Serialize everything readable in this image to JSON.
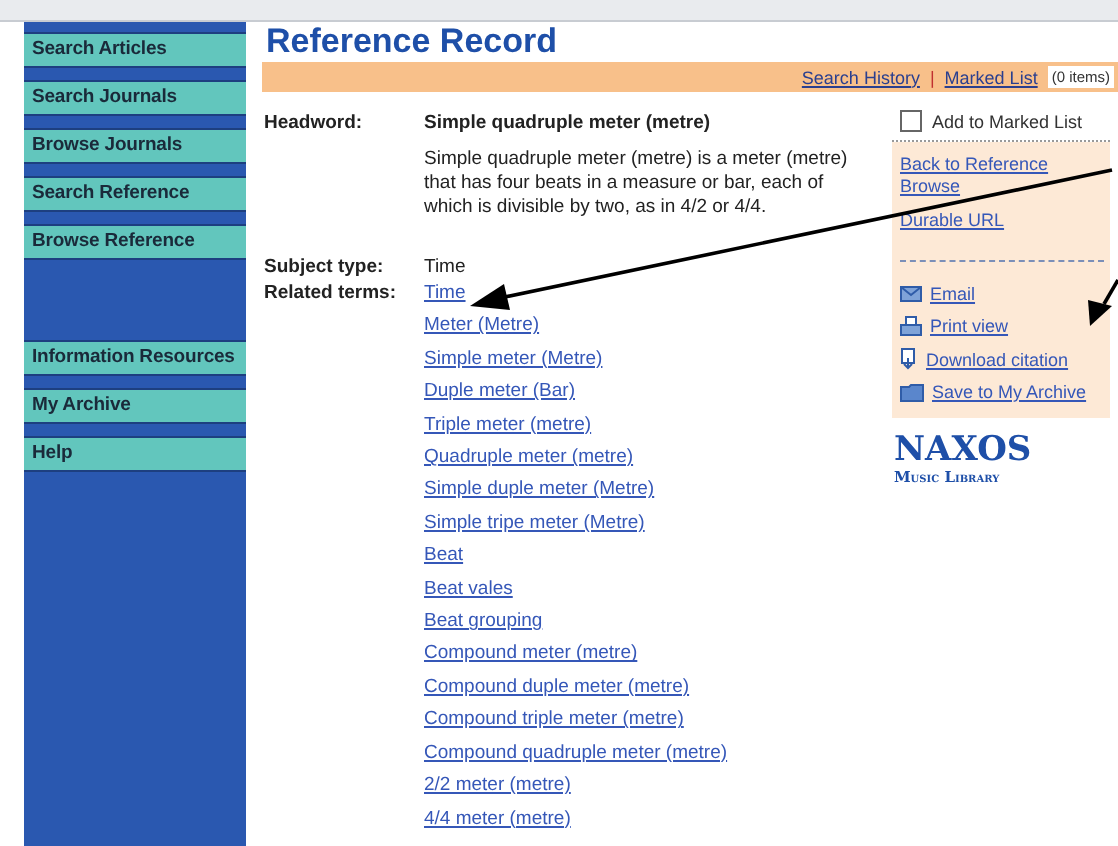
{
  "sidebar": {
    "groups": [
      {
        "items": [
          {
            "label": "Search Articles"
          },
          {
            "label": "Search Journals"
          },
          {
            "label": "Browse Journals"
          },
          {
            "label": "Search Reference"
          },
          {
            "label": "Browse Reference"
          }
        ]
      },
      {
        "items": [
          {
            "label": "Information Resources"
          },
          {
            "label": "My Archive"
          },
          {
            "label": "Help"
          }
        ]
      }
    ]
  },
  "page_title": "Reference Record",
  "toolbar": {
    "links": [
      {
        "label": "Search History"
      },
      {
        "label": "Marked List"
      }
    ],
    "separator": "|",
    "count": "(0 items)"
  },
  "record": {
    "headword_label": "Headword:",
    "headword": "Simple quadruple meter (metre)",
    "definition": "Simple quadruple meter (metre) is a meter (metre) that has four beats in a measure or bar, each of which is divisible by two, as in 4/2 or 4/4.",
    "subject_label": "Subject type:",
    "subject": "Time",
    "related_label": "Related terms:",
    "related_terms": [
      "Time",
      "Meter (Metre)",
      "Simple meter (Metre)",
      "Duple meter (Bar)",
      "Triple meter (metre)",
      "Quadruple meter (metre)",
      "Simple duple meter (Metre)",
      "Simple tripe meter (Metre)",
      "Beat",
      "Beat vales",
      "Beat grouping",
      "Compound meter (metre)",
      "Compound duple meter (metre)",
      "Compound triple meter (metre)",
      "Compound quadruple meter (metre)",
      "2/2 meter (metre)",
      "4/4 meter (metre)"
    ]
  },
  "actions": {
    "marked": {
      "label": "Add to Marked List",
      "checked": false
    },
    "links": [
      {
        "label": "Back to Reference Browse"
      },
      {
        "label": "Durable URL"
      }
    ],
    "tools": [
      {
        "kind": "email",
        "label": "Email"
      },
      {
        "kind": "print",
        "label": "Print view"
      },
      {
        "kind": "download",
        "label": "Download citation"
      },
      {
        "kind": "folder",
        "label": "Save to My Archive"
      }
    ]
  },
  "logo": {
    "name": "NAXOS",
    "subtitle": "Music Library"
  }
}
